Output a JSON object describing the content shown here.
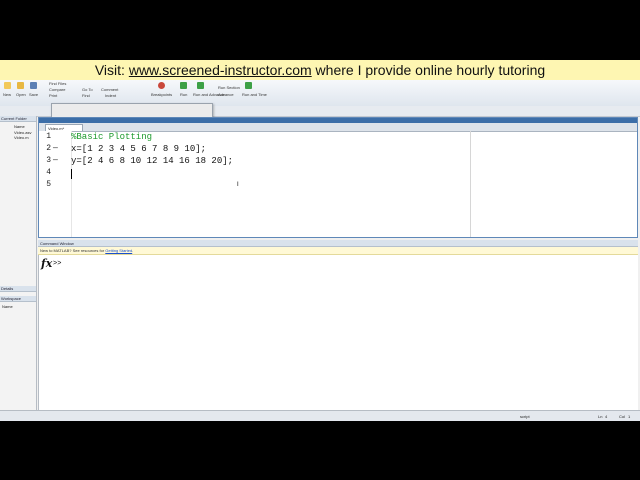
{
  "banner": {
    "prefix": "Visit: ",
    "link": "www.screened-instructor.com",
    "suffix": " where I provide online hourly tutoring"
  },
  "editor": {
    "tab_label": "Video.m*",
    "lines": [
      {
        "num": "1",
        "marker": "",
        "text": "%Basic Plotting",
        "comment": true
      },
      {
        "num": "2",
        "marker": "—",
        "text": "x=[1 2 3 4 5 6 7 8 9 10];",
        "comment": false
      },
      {
        "num": "3",
        "marker": "—",
        "text": "y=[2 4 6 8 10 12 14 16 18 20];",
        "comment": false
      },
      {
        "num": "4",
        "marker": "",
        "text": "",
        "comment": false
      },
      {
        "num": "5",
        "marker": "",
        "text": "",
        "comment": false
      }
    ]
  },
  "command_window": {
    "title": "Command Window",
    "info_prefix": "New to MATLAB? See resources for ",
    "info_link": "Getting Started",
    "info_suffix": ".",
    "fx": "fx",
    "prompt": ">>"
  },
  "left_pane": {
    "current_folder_title": "Current Folder",
    "name_header": "Name",
    "files": [
      "Video.asv",
      "Video.m"
    ],
    "details_title": "Details",
    "workspace_title": "Workspace",
    "workspace_name_header": "Name"
  },
  "toolstrip": {
    "items": [
      "New",
      "Open",
      "Save",
      "Find Files",
      "Compare",
      "Print",
      "Go To",
      "Find",
      "Comment",
      "Indent",
      "Breakpoints",
      "Run",
      "Run and Advance",
      "Run Section",
      "Advance",
      "Run and Time"
    ]
  },
  "status": {
    "script": "script",
    "ln_label": "Ln",
    "ln": "4",
    "col_label": "Col",
    "col": "1"
  }
}
